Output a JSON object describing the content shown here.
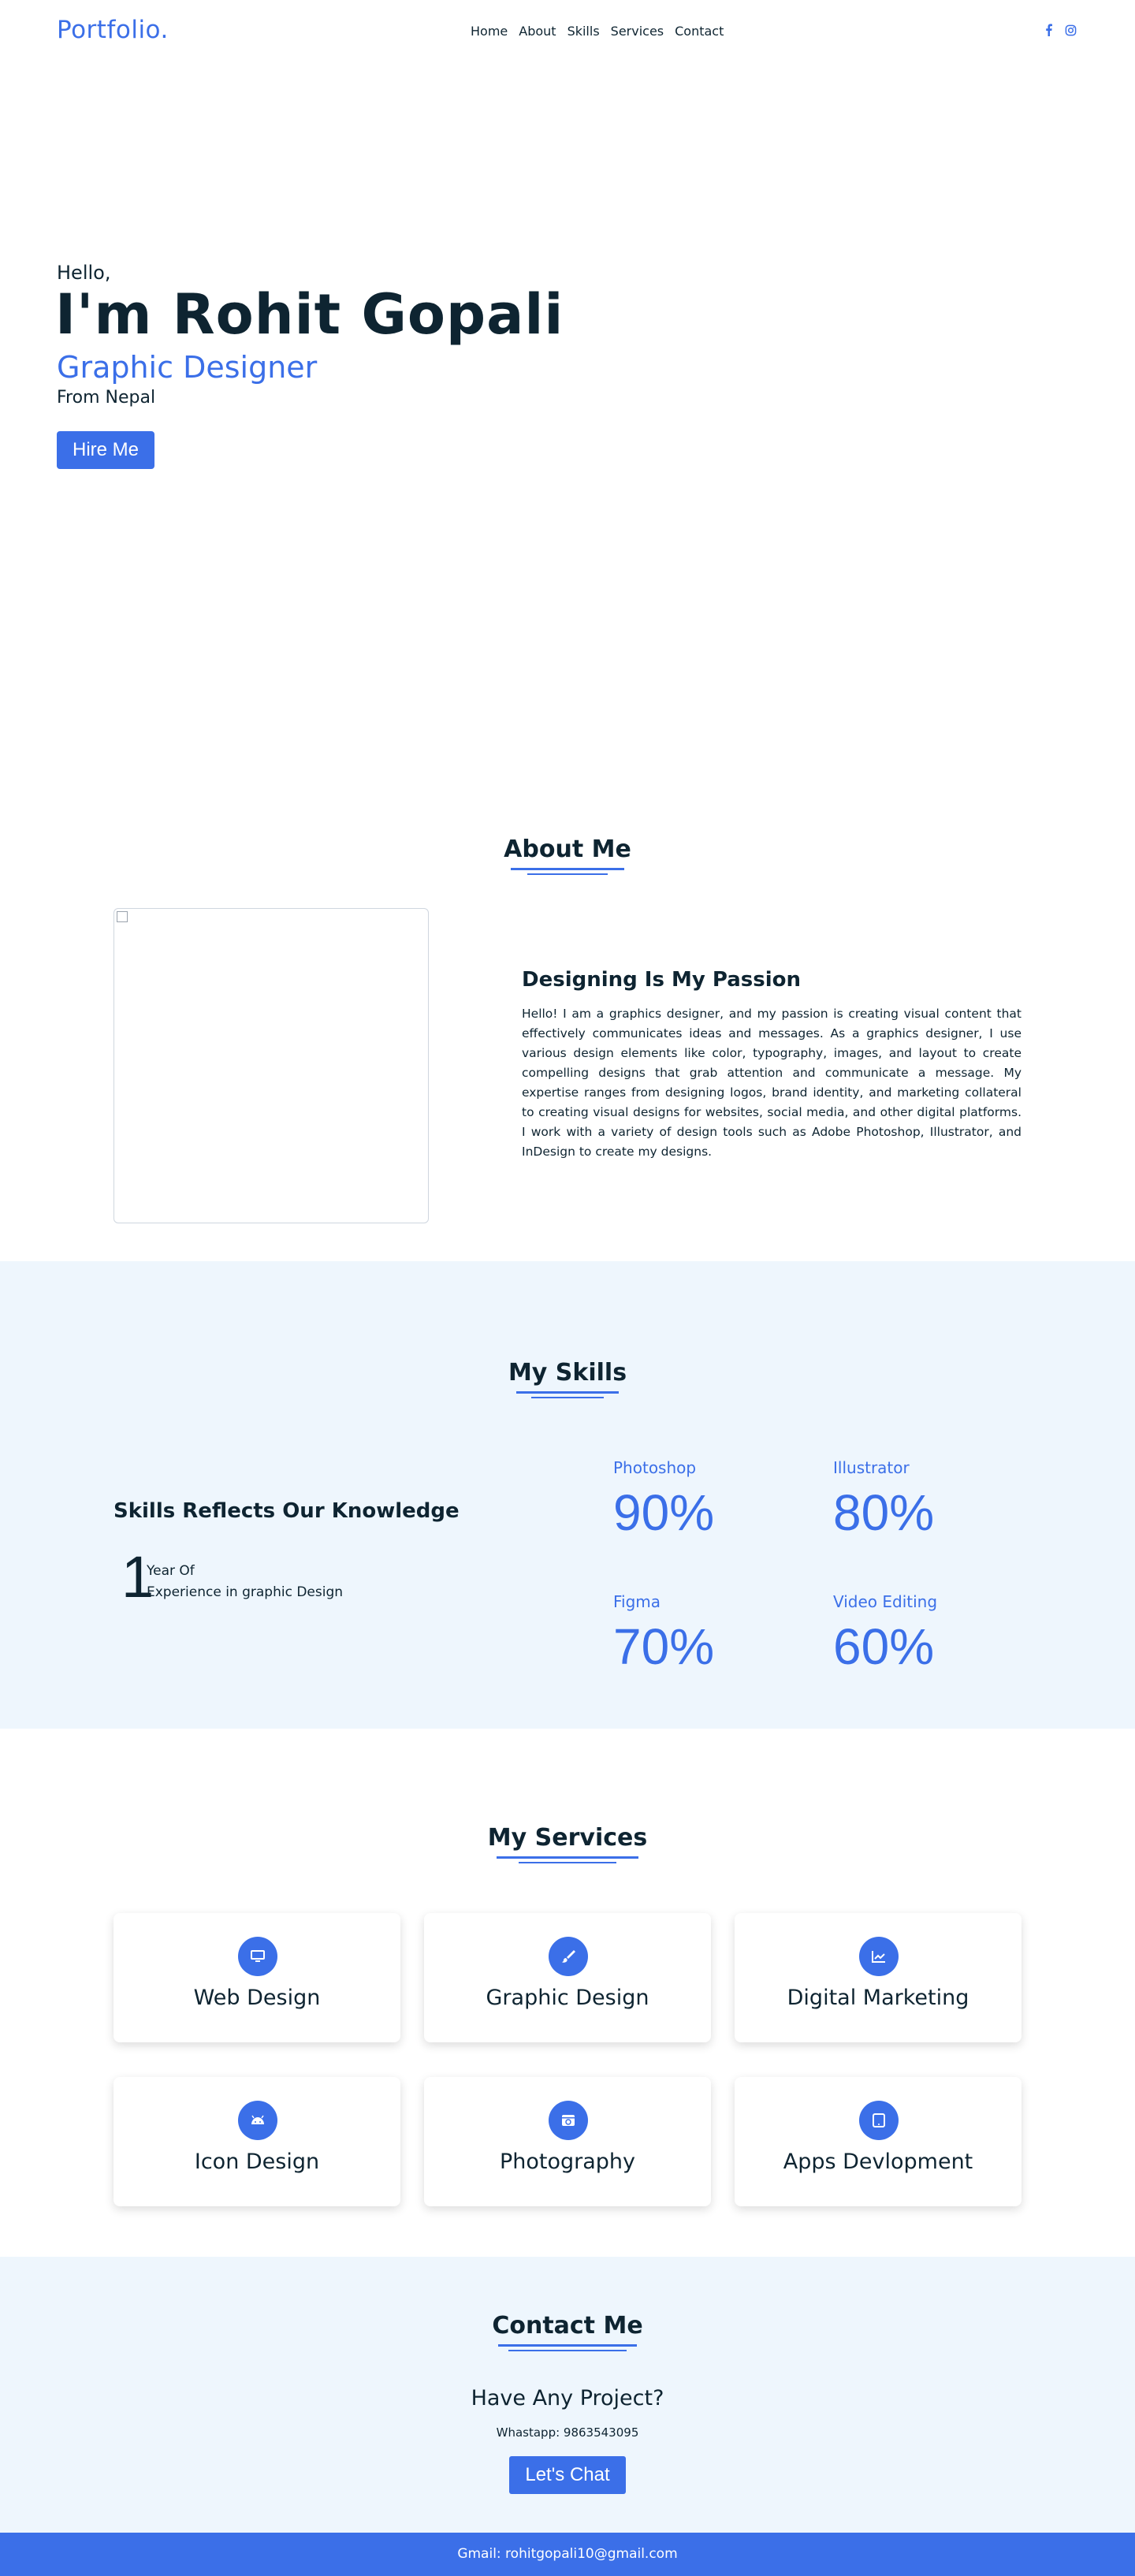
{
  "nav": {
    "logo": "Portfolio.",
    "links": [
      "Home",
      "About",
      "Skills",
      "Services",
      "Contact"
    ],
    "social_icons": [
      "facebook-icon",
      "instagram-icon"
    ]
  },
  "hero": {
    "greeting": "Hello,",
    "name": "I'm Rohit Gopali",
    "role": "Graphic Designer",
    "location": "From Nepal",
    "cta": "Hire Me"
  },
  "about": {
    "title": "About Me",
    "heading": "Designing Is My Passion",
    "text": "Hello! I am a graphics designer, and my passion is creating visual content that effectively communicates ideas and messages. As a graphics designer, I use various design elements like color, typography, images, and layout to create compelling designs that grab attention and communicate a message. My expertise ranges from designing logos, brand identity, and marketing collateral to creating visual designs for websites, social media, and other digital platforms. I work with a variety of design tools such as Adobe Photoshop, Illustrator, and InDesign to create my designs."
  },
  "skills": {
    "title": "My Skills",
    "heading": "Skills Reflects Our Knowledge",
    "experience_number": "1",
    "experience_line1": "Year Of",
    "experience_line2": "Experience in graphic Design",
    "items": [
      {
        "name": "Photoshop",
        "percent": "90%"
      },
      {
        "name": "Illustrator",
        "percent": "80%"
      },
      {
        "name": "Figma",
        "percent": "70%"
      },
      {
        "name": "Video Editing",
        "percent": "60%"
      }
    ]
  },
  "services": {
    "title": "My Services",
    "items": [
      {
        "label": "Web Design",
        "icon": "desktop-icon"
      },
      {
        "label": "Graphic Design",
        "icon": "paintbrush-icon"
      },
      {
        "label": "Digital Marketing",
        "icon": "chart-line-icon"
      },
      {
        "label": "Icon Design",
        "icon": "android-icon"
      },
      {
        "label": "Photography",
        "icon": "camera-icon"
      },
      {
        "label": "Apps Devlopment",
        "icon": "tablet-icon"
      }
    ]
  },
  "contact": {
    "title": "Contact Me",
    "heading": "Have Any Project?",
    "whatsapp": "Whastapp: 9863543095",
    "cta": "Let's Chat"
  },
  "footer": {
    "text": "Gmail: rohitgopali10@gmail.com"
  },
  "colors": {
    "accent": "#3b6fe8",
    "text": "#0e2431",
    "section_bg": "#eef6fd"
  }
}
